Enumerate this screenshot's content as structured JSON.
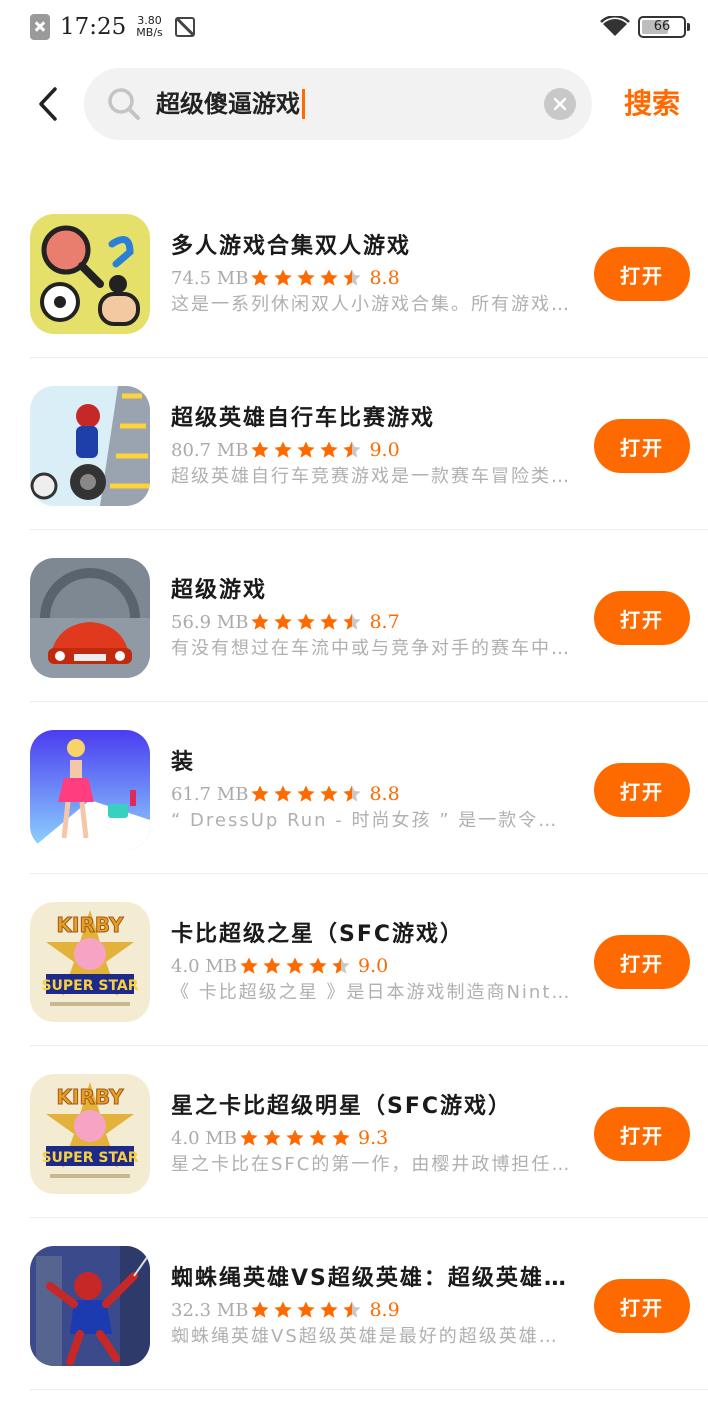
{
  "status_bar": {
    "time": "17:25",
    "net_speed_value": "3.80",
    "net_speed_unit": "MB/s",
    "battery": "66",
    "battery_level": 0.66,
    "icons": [
      "sim-off-icon",
      "screenshot-icon",
      "wifi-icon",
      "battery-icon"
    ]
  },
  "search": {
    "query": "超级傻逼游戏",
    "button_label": "搜索",
    "icons": [
      "back-arrow-icon",
      "search-icon",
      "clear-icon"
    ]
  },
  "theme": {
    "accent": "#ff6a00",
    "star_empty": "#c8c8c8"
  },
  "results": [
    {
      "title": "多人游戏合集双人游戏",
      "size": "74.5 MB",
      "rating": "8.8",
      "stars": 4.5,
      "desc": "这是一系列休闲双人小游戏合集。所有游戏都可以两人同时在一台设备上玩。",
      "button": "打开"
    },
    {
      "title": "超级英雄自行车比赛游戏",
      "size": "80.7 MB",
      "rating": "9.0",
      "stars": 4.5,
      "desc": "超级英雄自行车竞赛游戏是一款赛车冒险类游戏。",
      "button": "打开"
    },
    {
      "title": "超级游戏",
      "size": "56.9 MB",
      "rating": "8.7",
      "stars": 4.5,
      "desc": "有没有想过在车流中或与竞争对手的赛车中飞驰？",
      "button": "打开"
    },
    {
      "title": "装",
      "size": "61.7 MB",
      "rating": "8.8",
      "stars": 4.5,
      "desc": "“ DressUp Run - 时尚女孩 ” 是一款令人上瘾的换装跑酷游戏。",
      "button": "打开"
    },
    {
      "title": "卡比超级之星（SFC游戏）",
      "size": "4.0 MB",
      "rating": "9.0",
      "stars": 4.5,
      "desc": "《 卡比超级之星 》是日本游戏制造商Nintendo发行的游戏。",
      "button": "打开"
    },
    {
      "title": "星之卡比超级明星（SFC游戏）",
      "size": "4.0 MB",
      "rating": "9.3",
      "stars": 5,
      "desc": "星之卡比在SFC的第一作，由樱井政博担任总监督。",
      "button": "打开"
    },
    {
      "title": "蜘蛛绳英雄VS超级英雄：超级英雄格斗",
      "size": "32.3 MB",
      "rating": "8.9",
      "stars": 4.5,
      "desc": "蜘蛛绳英雄VS超级英雄是最好的超级英雄格斗游戏。",
      "button": "打开"
    }
  ],
  "app_icons": [
    "party-games-icon",
    "hero-bike-icon",
    "sports-car-icon",
    "dressup-run-icon",
    "kirby-super-star-icon",
    "kirby-super-star-icon",
    "spider-hero-icon"
  ]
}
